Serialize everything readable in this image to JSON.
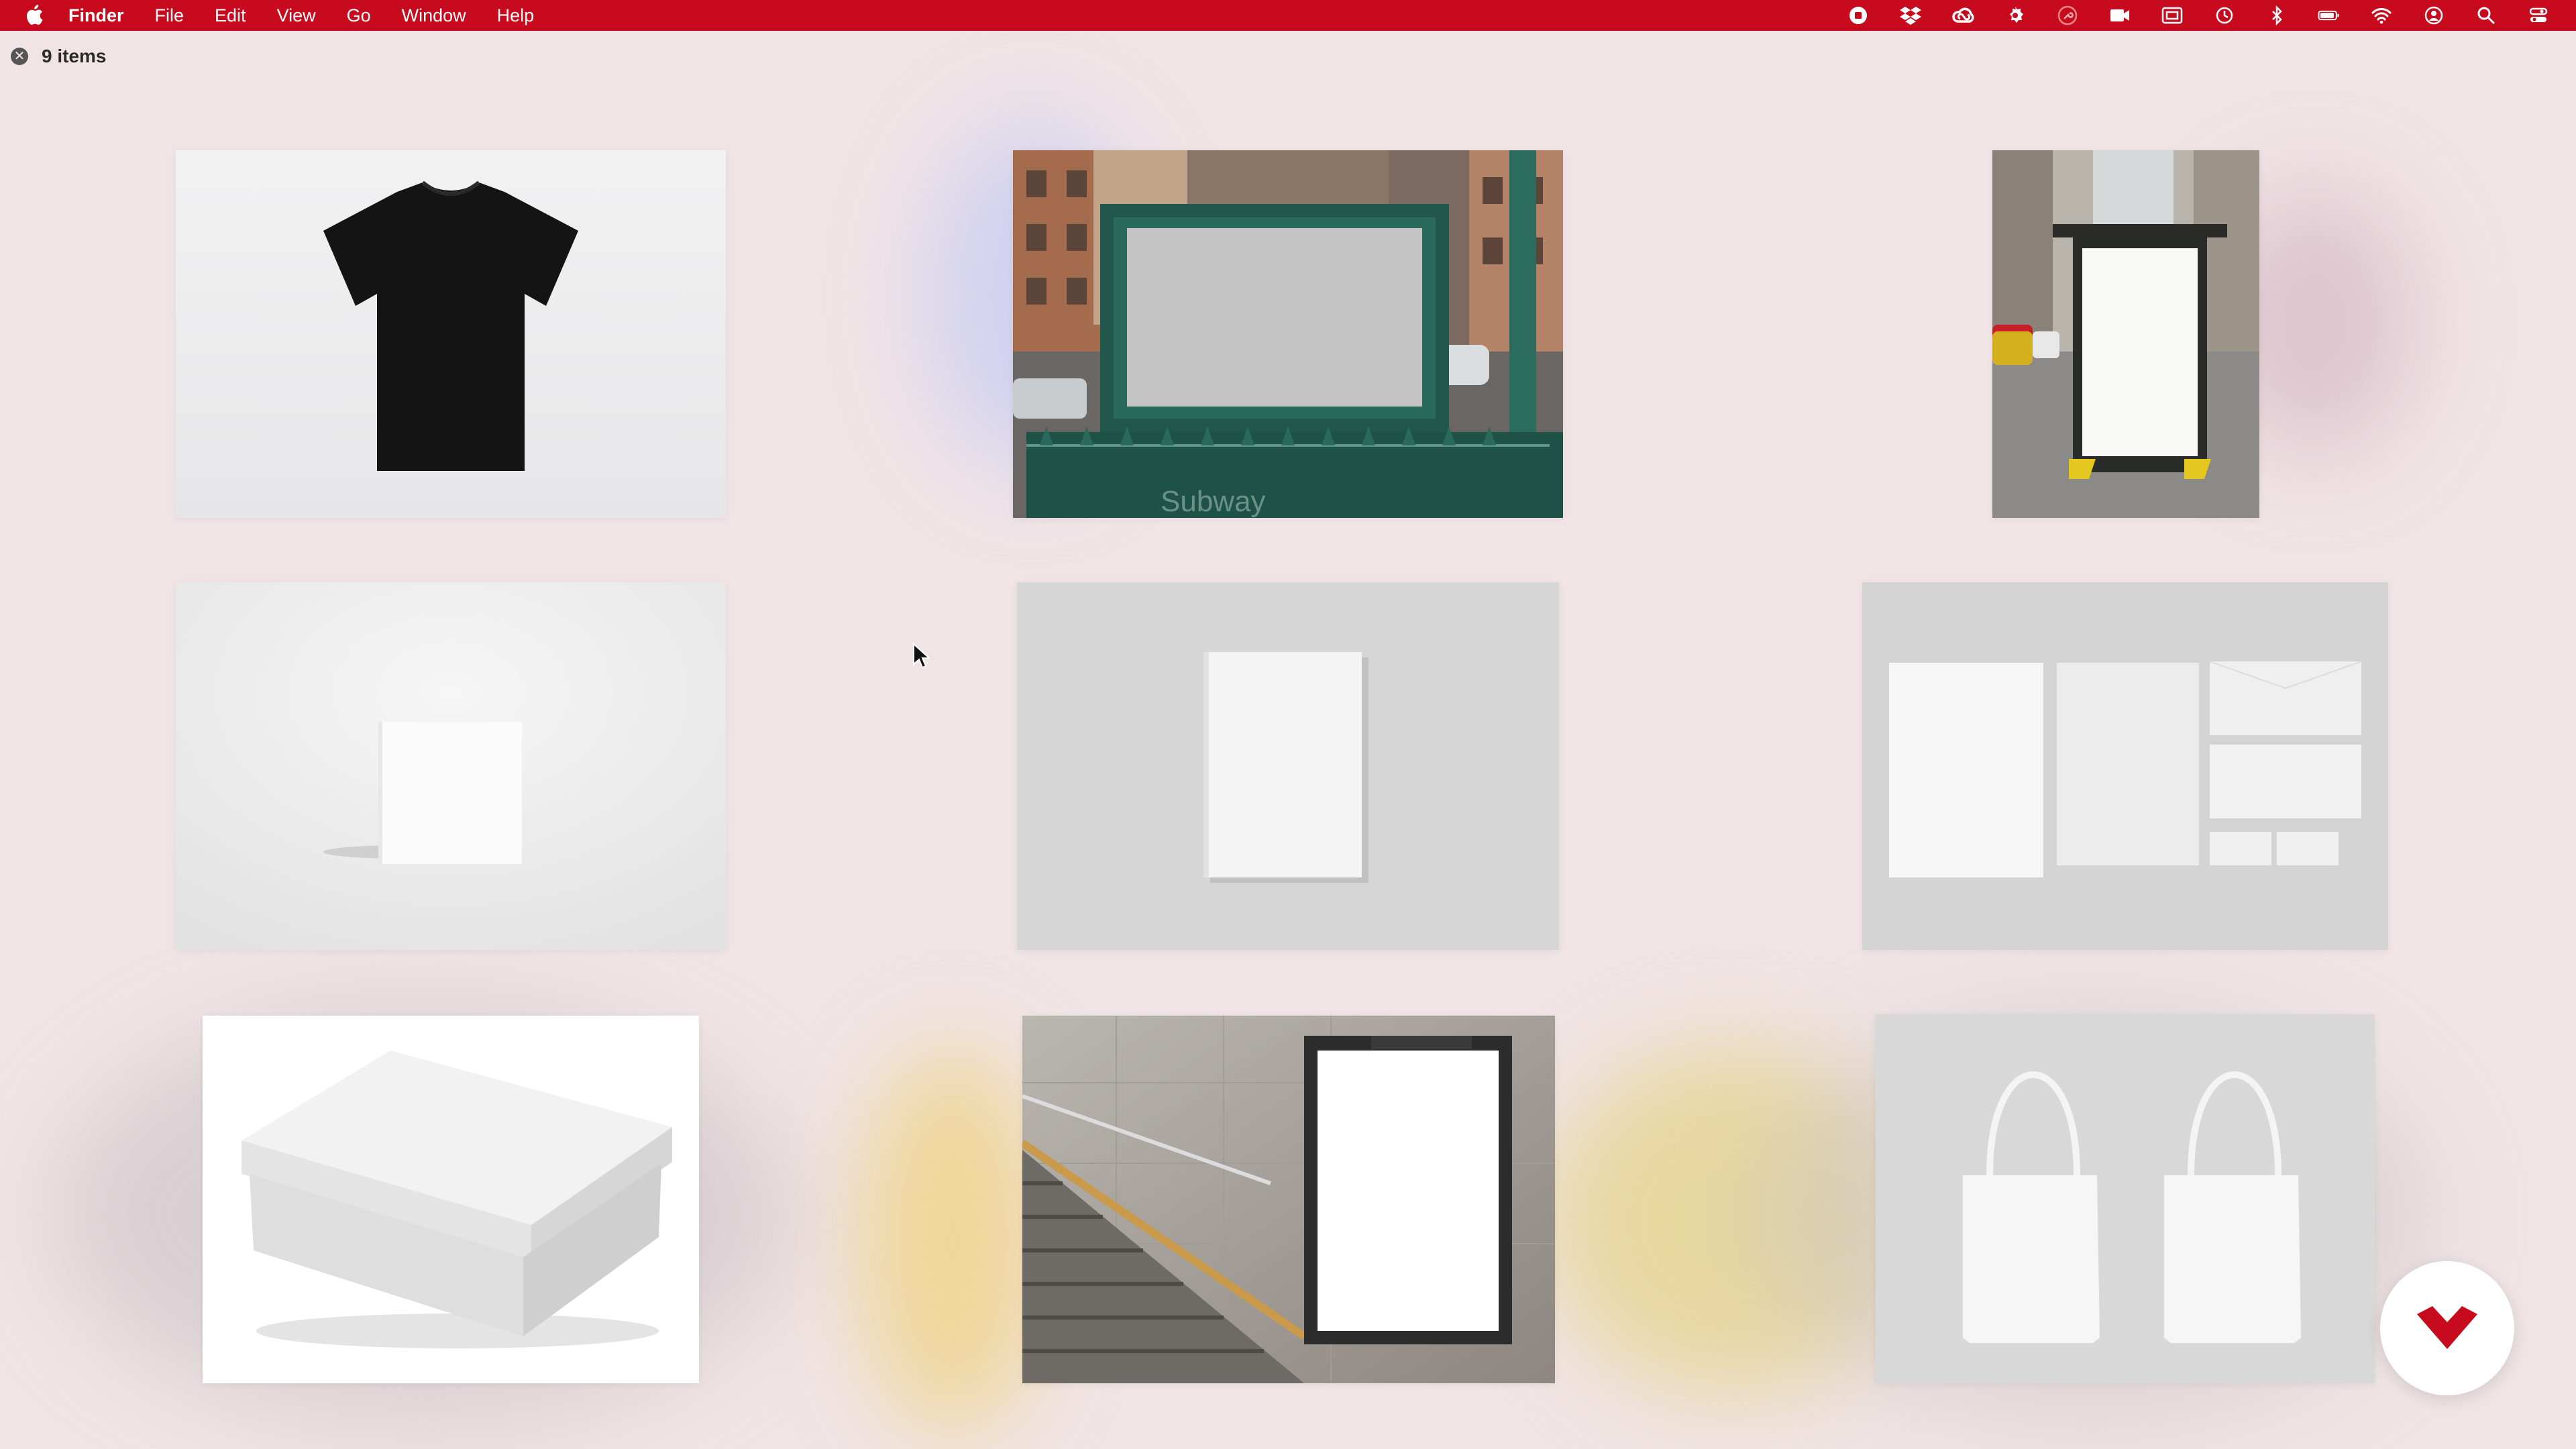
{
  "menubar": {
    "app_name": "Finder",
    "items": [
      "File",
      "Edit",
      "View",
      "Go",
      "Window",
      "Help"
    ],
    "background_color": "#c80a1e",
    "status_icons": [
      "record-icon",
      "dropbox-icon",
      "creative-cloud-icon",
      "gear-badge-icon",
      "key-icon",
      "camera-icon",
      "screen-icon",
      "time-machine-icon",
      "bluetooth-icon",
      "battery-icon",
      "wifi-icon",
      "user-icon",
      "spotlight-icon",
      "control-center-icon"
    ]
  },
  "window": {
    "items_count": "9 items"
  },
  "thumbnails": [
    {
      "name": "black-tshirt-mockup"
    },
    {
      "name": "subway-billboard-mockup"
    },
    {
      "name": "bus-stop-poster-mockup"
    },
    {
      "name": "book-on-white-mockup"
    },
    {
      "name": "book-on-grey-mockup"
    },
    {
      "name": "stationery-mockup"
    },
    {
      "name": "shoe-box-mockup"
    },
    {
      "name": "stairway-poster-mockup"
    },
    {
      "name": "tote-bags-mockup"
    }
  ],
  "badge": {
    "icon": "brand-logo-icon",
    "color": "#c80a1e"
  }
}
